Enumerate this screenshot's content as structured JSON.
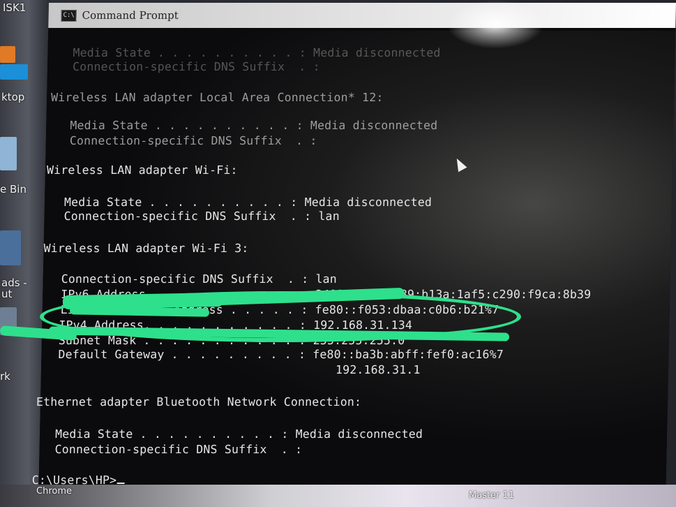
{
  "desktop": {
    "labels": [
      "ISK1",
      "ktop",
      "e Bin",
      "ads -",
      "ut",
      "rk"
    ]
  },
  "window": {
    "title": "Command Prompt",
    "icon": "cmd-icon",
    "icon_text": "C:\\"
  },
  "console": {
    "lines": [
      "Media State . . . . . . . . . . : Media disconnected",
      "Connection-specific DNS Suffix  . :",
      "Wireless LAN adapter Local Area Connection* 12:",
      "Media State . . . . . . . . . . : Media disconnected",
      "Connection-specific DNS Suffix  . :",
      "Wireless LAN adapter Wi-Fi:",
      "Media State . . . . . . . . . . : Media disconnected",
      "Connection-specific DNS Suffix  . : lan",
      "Wireless LAN adapter Wi-Fi 3:",
      "Connection-specific DNS Suffix  . : lan",
      "IPv6 Address. . . . . . . . . . . : 2409:40d0:1189:b13a:1af5:c290:f9ca:8b39",
      "Link-local IPv6 Address . . . . . : fe80::f053:dbaa:c0b6:b21%7",
      "IPv4 Address. . . . . . . . . . . : 192.168.31.134",
      "Subnet Mask . . . . . . . . . . . : 255.255.255.0",
      "Default Gateway . . . . . . . . . : fe80::ba3b:abff:fef0:ac16%7",
      "192.168.31.1",
      "Ethernet adapter Bluetooth Network Connection:",
      "Media State . . . . . . . . . . : Media disconnected",
      "Connection-specific DNS Suffix  . :",
      "C:\\Users\\HP>"
    ]
  },
  "taskbar": {
    "left_label": "Chrome",
    "right_label": "Master 11"
  },
  "colors": {
    "annotation": "#2ee08b",
    "console_text": "#e6e6e6",
    "console_bg": "#0b0b0d"
  }
}
